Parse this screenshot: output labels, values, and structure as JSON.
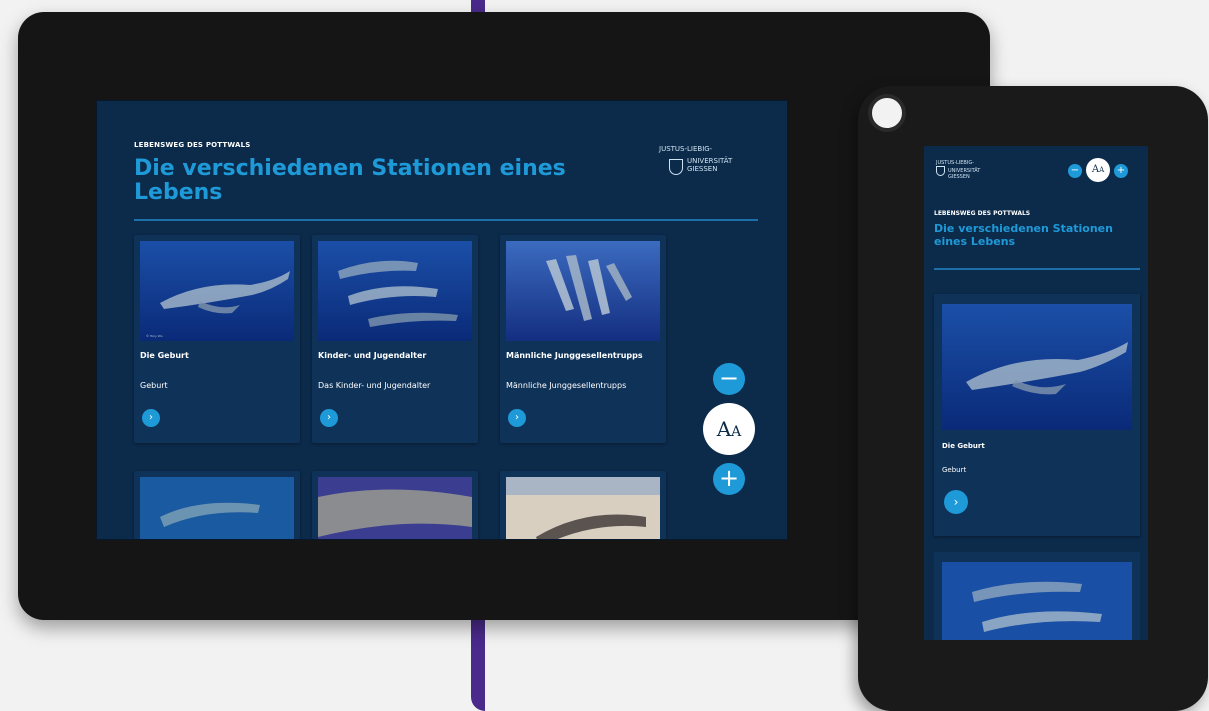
{
  "page": {
    "kicker": "LEBENSWEG DES POTTWALS",
    "title": "Die verschiedenen Stationen eines Lebens"
  },
  "logo": {
    "line1": "JUSTUS-LIEBIG-",
    "line2": "UNIVERSITÄT",
    "line3": "GIESSEN"
  },
  "cards": [
    {
      "title": "Die Geburt",
      "subtitle": "Geburt",
      "button_icon": "chevron-right-icon"
    },
    {
      "title": "Kinder- und Jugendalter",
      "subtitle": "Das Kinder- und Jugendalter",
      "button_icon": "chevron-right-icon"
    },
    {
      "title": "Männliche Junggesellentrupps",
      "subtitle": "Männliche Junggesellentrupps",
      "button_icon": "chevron-right-icon"
    }
  ],
  "font_controls": {
    "decrease": "−",
    "size_label_big": "A",
    "size_label_small": "A",
    "increase": "+"
  },
  "colors": {
    "screen_bg": "#0c2a4a",
    "card_bg": "#0f3258",
    "accent": "#1e9ad8",
    "bezel": "#151515",
    "decor_line": "#4a2a8a"
  }
}
